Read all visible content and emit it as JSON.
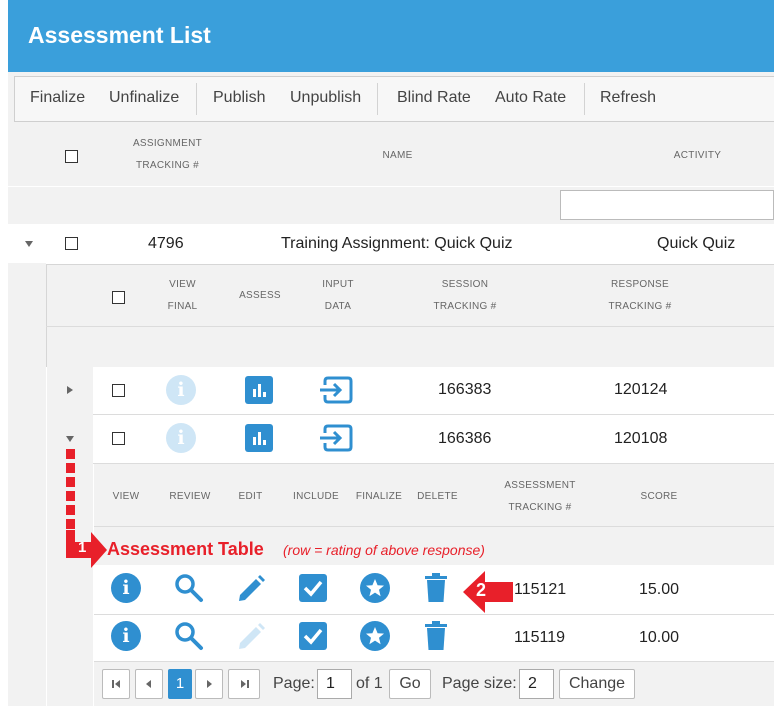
{
  "header": {
    "title": "Assessment List"
  },
  "toolbar": {
    "finalize": "Finalize",
    "unfinalize": "Unfinalize",
    "publish": "Publish",
    "unpublish": "Unpublish",
    "blind_rate": "Blind Rate",
    "auto_rate": "Auto Rate",
    "refresh": "Refresh"
  },
  "grid": {
    "columns": {
      "assignment_tracking_1": "ASSIGNMENT",
      "assignment_tracking_2": "TRACKING #",
      "name": "NAME",
      "activity": "ACTIVITY"
    },
    "row": {
      "tracking": "4796",
      "name": "Training Assignment: Quick Quiz",
      "activity": "Quick Quiz"
    }
  },
  "sessions": {
    "columns": {
      "view_final_1": "VIEW",
      "view_final_2": "FINAL",
      "assess": "ASSESS",
      "input_data_1": "INPUT",
      "input_data_2": "DATA",
      "session_1": "SESSION",
      "session_2": "TRACKING #",
      "response_1": "RESPONSE",
      "response_2": "TRACKING #"
    },
    "rows": [
      {
        "session": "166383",
        "response": "120124"
      },
      {
        "session": "166386",
        "response": "120108"
      }
    ]
  },
  "assessments": {
    "columns": {
      "view": "VIEW",
      "review": "REVIEW",
      "edit": "EDIT",
      "include": "INCLUDE",
      "finalize": "FINALIZE",
      "delete": "DELETE",
      "tracking_1": "ASSESSMENT",
      "tracking_2": "TRACKING #",
      "score": "SCORE"
    },
    "rows": [
      {
        "tracking": "115121",
        "score": "15.00"
      },
      {
        "tracking": "115119",
        "score": "10.00"
      }
    ]
  },
  "annotation": {
    "marker1": "1",
    "title": "Assessment Table",
    "subtitle": "(row = rating of above response)",
    "marker2": "2"
  },
  "pager": {
    "current_page": "1",
    "page_label": "Page:",
    "page_value": "1",
    "of_label": "of 1",
    "go": "Go",
    "size_label": "Page size:",
    "size_value": "2",
    "change": "Change"
  },
  "colors": {
    "header": "#3a9fdb",
    "icon_blue": "#2f8fd0",
    "annotation_red": "#e8202a"
  }
}
